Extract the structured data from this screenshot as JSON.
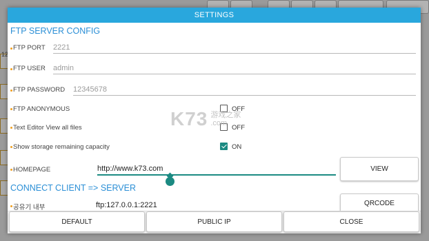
{
  "background_app": {
    "side_number": "12"
  },
  "dialog": {
    "title": "SETTINGS"
  },
  "ftp_server": {
    "section_title": "FTP SERVER CONFIG",
    "port": {
      "label": "FTP PORT",
      "value": "2221"
    },
    "user": {
      "label": "FTP USER",
      "value": "admin"
    },
    "password": {
      "label": "FTP PASSWORD",
      "value": "12345678"
    },
    "anonymous": {
      "label": "FTP ANONYMOUS",
      "state": "OFF",
      "checked": false
    },
    "text_editor": {
      "label": "Text Editor View all files",
      "state": "OFF",
      "checked": false
    },
    "storage": {
      "label": "Show storage remaining capacity",
      "state": "ON",
      "checked": true
    },
    "homepage": {
      "label": "HOMEPAGE",
      "value": "http://www.k73.com",
      "view_button": "VIEW"
    }
  },
  "connect_client": {
    "section_title": "CONNECT CLIENT => SERVER",
    "internal": {
      "label": "공유기 내부",
      "value": "ftp:127.0.0.1:2221",
      "qrcode_button": "QRCODE"
    }
  },
  "footer": {
    "default_button": "DEFAULT",
    "public_ip_button": "PUBLIC IP",
    "close_button": "CLOSE"
  },
  "watermark": {
    "main": "K73",
    "line1": "游戏之家",
    "line2": ".com"
  },
  "colors": {
    "title_bar": "#29a7dd",
    "section_title": "#2b8fd6",
    "accent": "#1b8a82",
    "bullet": "#f0a020"
  }
}
